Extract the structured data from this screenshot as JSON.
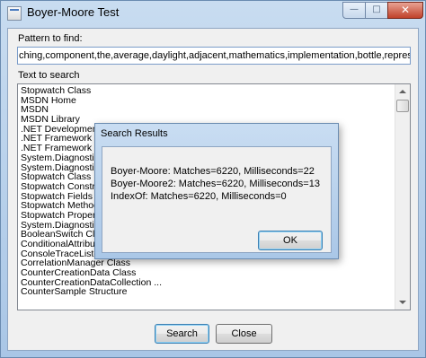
{
  "window": {
    "title": "Boyer-Moore Test",
    "min_glyph": "—",
    "max_glyph": "□",
    "close_glyph": "✕"
  },
  "pattern": {
    "label": "Pattern to find:",
    "value": "ching,component,the,average,daylight,adjacent,mathematics,implementation,bottle,representation,integration"
  },
  "search_text": {
    "label": "Text to search",
    "items": [
      "Stopwatch Class",
      "MSDN Home",
      "MSDN",
      "MSDN Library",
      ".NET Development",
      ".NET Framework 4",
      ".NET Framework Class Library",
      "System.Diagnostics Namespace",
      "System.Diagnostics",
      "Stopwatch Class",
      "Stopwatch Constructor",
      "Stopwatch Fields",
      "Stopwatch Methods",
      "Stopwatch Properties",
      "System.Diagnostics",
      "BooleanSwitch Class",
      "ConditionalAttribute Class",
      "ConsoleTraceListener Class",
      "CorrelationManager Class",
      "CounterCreationData Class",
      "CounterCreationDataCollection ...",
      "CounterSample Structure"
    ]
  },
  "buttons": {
    "search": "Search",
    "close": "Close"
  },
  "dialog": {
    "title": "Search Results",
    "lines": [
      "Boyer-Moore: Matches=6220, Milliseconds=22",
      "Boyer-Moore2: Matches=6220, Milliseconds=13",
      "IndexOf: Matches=6220, Milliseconds=0"
    ],
    "ok": "OK"
  }
}
